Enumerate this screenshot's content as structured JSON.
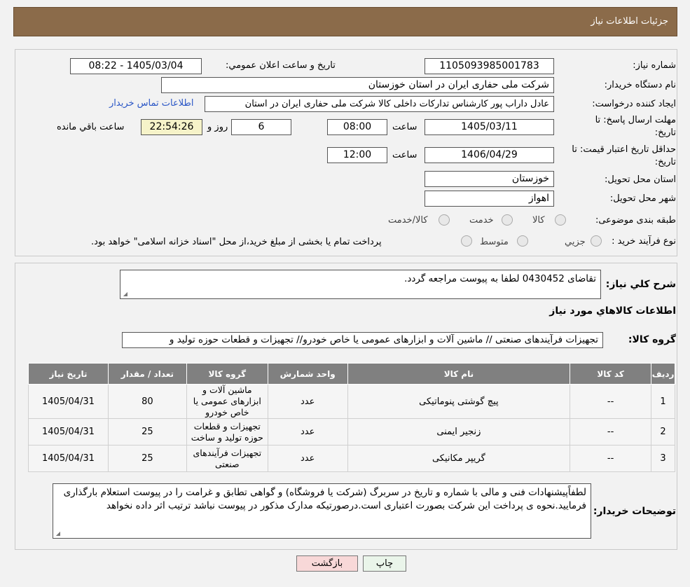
{
  "header": {
    "title": "جزئیات اطلاعات نیاز"
  },
  "form": {
    "need_number_label": "شماره نیاز:",
    "need_number": "1105093985001783",
    "announce_label": "تاريخ و ساعت اعلان عمومي:",
    "announce_value": "1405/03/04 - 08:22",
    "buyer_org_label": "نام دستگاه خريدار:",
    "buyer_org": "شرکت ملی حفاری ایران در استان خوزستان",
    "creator_label": "ايجاد كننده درخواست:",
    "creator": "عادل داراب پور کارشناس تدارکات داخلی کالا شرکت ملی حفاری ایران در استان",
    "contact_link": "اطلاعات تماس خريدار",
    "deadline_label_1": "مهلت ارسال پاسخ: تا",
    "deadline_label_2": "تاريخ:",
    "deadline_date": "1405/03/11",
    "time_word": "ساعت",
    "deadline_time": "08:00",
    "days_value": "6",
    "days_word": "روز و",
    "remaining_time": "22:54:26",
    "remaining_word": "ساعت باقي مانده",
    "validity_label_1": "حداقل تاريخ اعتبار قيمت: تا",
    "validity_label_2": "تاريخ:",
    "validity_date": "1406/04/29",
    "validity_time": "12:00",
    "province_label": "استان محل تحويل:",
    "province": "خوزستان",
    "city_label": "شهر محل تحويل:",
    "city": "اهواز",
    "category_label": "طبقه بندی موضوعی:",
    "category_options": [
      "کالا",
      "خدمت",
      "کالا/خدمت"
    ],
    "process_label": "نوع فرآيند خريد :",
    "process_options": [
      "جزيي",
      "متوسط"
    ],
    "process_note": "پرداخت تمام یا بخشی از مبلغ خرید،از محل \"اسناد خزانه اسلامی\" خواهد بود."
  },
  "details": {
    "summary_label": "شرح كلي نياز:",
    "summary": "تقاضای 0430452 لطفا به پیوست مراجعه گردد.",
    "goods_info_title": "اطلاعات كالاهاي مورد نياز",
    "goods_group_label": "گروه کالا:",
    "goods_group": "تجهیزات فرآیندهای صنعتی //  ماشین آلات و ابزارهای عمومی یا خاص خودرو// تجهیزات و قطعات حوزه تولید و"
  },
  "table": {
    "headers": [
      "رديف",
      "كد كالا",
      "نام كالا",
      "واحد شمارش",
      "گروه كالا",
      "تعداد / مقدار",
      "تاريخ نياز"
    ],
    "rows": [
      {
        "idx": "1",
        "code": "--",
        "name": "پیچ گوشتی پنوماتیکی",
        "unit": "عدد",
        "group": "ماشین آلات و ابزارهای عمومی یا خاص خودرو",
        "qty": "80",
        "date": "1405/04/31"
      },
      {
        "idx": "2",
        "code": "--",
        "name": "زنجیر ایمنی",
        "unit": "عدد",
        "group": "تجهیزات و قطعات حوزه تولید و ساخت",
        "qty": "25",
        "date": "1405/04/31"
      },
      {
        "idx": "3",
        "code": "--",
        "name": "گریپر مکانیکی",
        "unit": "عدد",
        "group": "تجهیزات فرآیندهای صنعتی",
        "qty": "25",
        "date": "1405/04/31"
      }
    ]
  },
  "buyer_notes": {
    "label": "توضيحات خريدار:",
    "text": "لطفاًپیشنهادات فنی و مالی با شماره و تاریخ در سربرگ (شرکت یا فروشگاه) و گواهی تطابق و غرامت را در پیوست استعلام بارگذاری فرمایید.نحوه ی پرداخت این شرکت بصورت اعتباری است.درصورتیکه مدارک مذکور در پیوست نباشد ترتیب اثر داده نخواهد"
  },
  "buttons": {
    "print": "چاپ",
    "back": "بازگشت"
  },
  "colors": {
    "header": "#8b6b4a",
    "link": "#2a56c6",
    "table_header": "#808080"
  }
}
